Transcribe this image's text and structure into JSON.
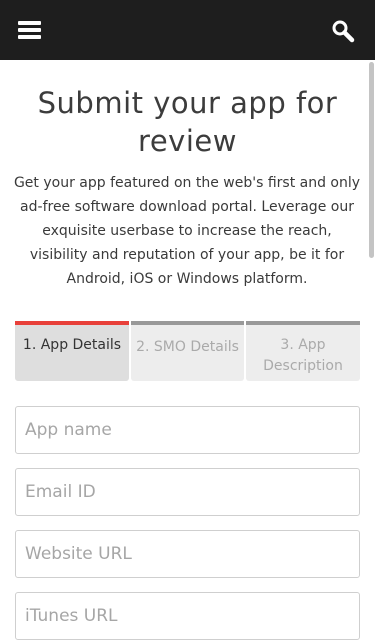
{
  "header": {
    "menu_icon": "hamburger-menu-icon",
    "search_icon": "search-icon",
    "background": "#1e1e1e"
  },
  "page": {
    "title": "Submit your app for review",
    "intro": "Get your app featured on the web's first and only ad-free software download portal. Leverage our exquisite userbase to increase the reach, visibility and reputation of your app, be it for Android, iOS or Windows platform."
  },
  "steps": [
    {
      "label": "1. App Details",
      "active": true
    },
    {
      "label": "2. SMO Details",
      "active": false
    },
    {
      "label": "3. App Description",
      "active": false
    }
  ],
  "form": {
    "app_name_placeholder": "App name",
    "email_placeholder": "Email ID",
    "website_placeholder": "Website URL",
    "itunes_placeholder": "iTunes URL"
  },
  "colors": {
    "active_step_accent": "#e8403a",
    "inactive_step_accent": "#999999"
  }
}
